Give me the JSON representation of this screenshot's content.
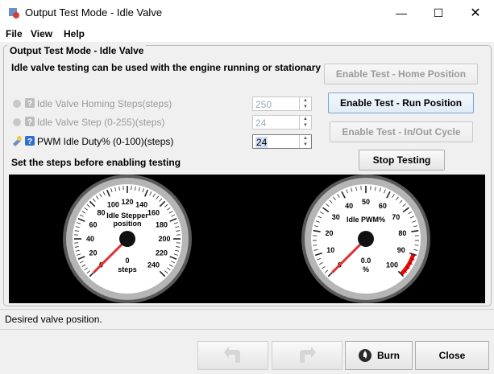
{
  "window": {
    "title": "Output Test Mode - Idle Valve"
  },
  "menu": [
    "File",
    "View",
    "Help"
  ],
  "panel": {
    "title": "Output Test Mode - Idle Valve",
    "intro": "Idle valve testing can be used with the engine running or stationary",
    "rows": [
      {
        "label": "Idle Valve Homing Steps(steps)",
        "value": "250",
        "enabled": false
      },
      {
        "label": "Idle Valve Step (0-255)(steps)",
        "value": "24",
        "enabled": false
      },
      {
        "label": "PWM Idle Duty% (0-100)(steps)",
        "value": "24",
        "enabled": true
      }
    ],
    "hint": "Set the steps before enabling testing",
    "buttons": {
      "home": "Enable Test - Home Position",
      "run": "Enable Test - Run Position",
      "inout": "Enable Test - In/Out Cycle",
      "stop": "Stop Testing"
    }
  },
  "gauges": {
    "stepper": {
      "title_line1": "Idle Stepper",
      "title_line2": "position",
      "value": "0",
      "unit": "steps",
      "ticks": [
        "0",
        "20",
        "40",
        "60",
        "80",
        "100",
        "120",
        "140",
        "160",
        "180",
        "200",
        "220",
        "240"
      ],
      "min": 0,
      "max": 240,
      "current": 0
    },
    "pwm": {
      "title": "Idle PWM%",
      "value": "0.0",
      "unit": "%",
      "ticks": [
        "0",
        "10",
        "20",
        "30",
        "40",
        "50",
        "60",
        "70",
        "80",
        "90",
        "100"
      ],
      "min": 0,
      "max": 100,
      "current": 0,
      "redline_from": 90
    }
  },
  "status": "Desired valve position.",
  "bottom_buttons": {
    "burn": "Burn",
    "close": "Close"
  },
  "colors": {
    "needle": "#e03030",
    "redline": "#ff0000",
    "gauge_bg": "#000000"
  }
}
